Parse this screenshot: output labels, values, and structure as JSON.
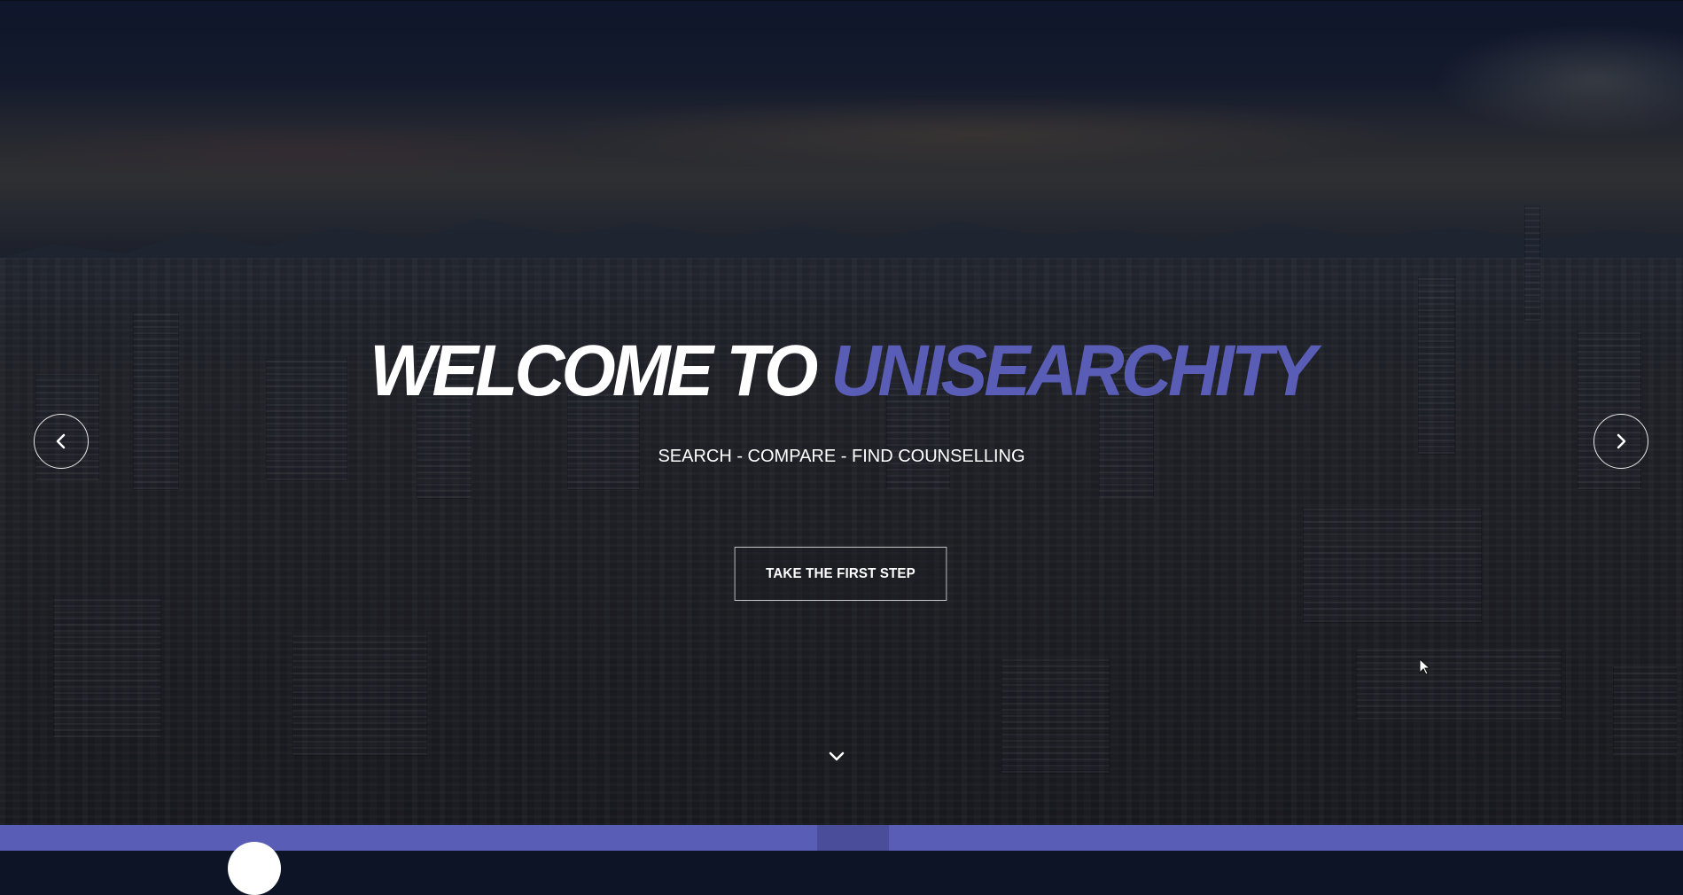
{
  "hero": {
    "title_prefix": "WELCOME TO ",
    "title_brand": "UNISEARCHITY",
    "subtitle": "SEARCH - COMPARE - FIND COUNSELLING",
    "cta_label": "TAKE THE FIRST STEP"
  },
  "icons": {
    "prev": "chevron-left-icon",
    "next": "chevron-right-icon",
    "scroll": "chevron-down-icon",
    "cursor": "mouse-pointer-icon"
  },
  "colors": {
    "brand": "#5a5db5",
    "text": "#ffffff",
    "bar_active": "#4a4d9a"
  }
}
